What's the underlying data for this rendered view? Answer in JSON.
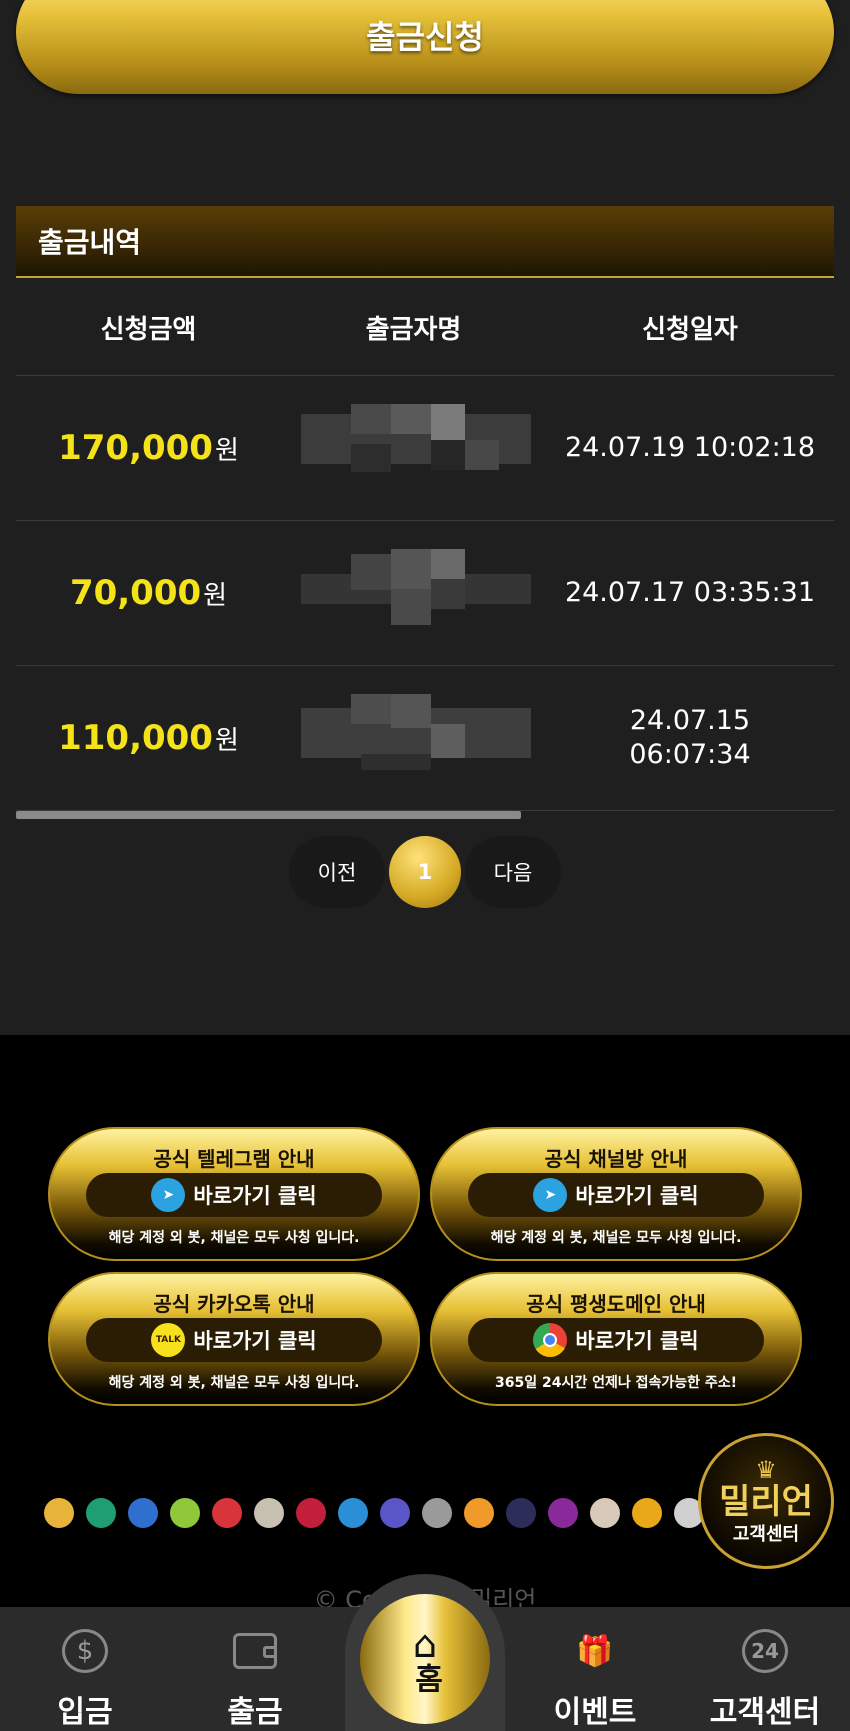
{
  "header": {
    "withdraw_request_label": "출금신청"
  },
  "history": {
    "title": "출금내역",
    "columns": [
      "신청금액",
      "출금자명",
      "신청일자"
    ],
    "currency_suffix": "원",
    "rows": [
      {
        "amount": "170,000",
        "date": "24.07.19 10:02:18",
        "date_line2": ""
      },
      {
        "amount": "70,000",
        "date": "24.07.17 03:35:31",
        "date_line2": ""
      },
      {
        "amount": "110,000",
        "date": "24.07.15",
        "date_line2": "06:07:34"
      }
    ]
  },
  "pagination": {
    "prev": "이전",
    "current": "1",
    "next": "다음"
  },
  "banners": [
    {
      "title": "공식 텔레그램 안내",
      "cta": "바로가기 클릭",
      "note": "해당 계정 외 봇, 채널은 모두 사칭 입니다.",
      "icon": "telegram-icon",
      "color": "#2aa3e0"
    },
    {
      "title": "공식 채널방 안내",
      "cta": "바로가기 클릭",
      "note": "해당 계정 외 봇, 채널은 모두 사칭 입니다.",
      "icon": "telegram-icon",
      "color": "#2aa3e0"
    },
    {
      "title": "공식 카카오톡 안내",
      "cta": "바로가기 클릭",
      "note": "해당 계정 외 봇, 채널은 모두 사칭 입니다.",
      "icon": "kakaotalk-icon",
      "color": "#f7e11c"
    },
    {
      "title": "공식 평생도메인 안내",
      "cta": "바로가기 클릭",
      "note": "365일 24시간 언제나 접속가능한 주소!",
      "icon": "chrome-icon",
      "color": "#4285f4"
    }
  ],
  "support_badge": {
    "brand": "밀리언",
    "label": "고객센터"
  },
  "copyright": "© Copyright 밀리언",
  "tabbar": {
    "deposit": "입금",
    "withdraw": "출금",
    "home": "홈",
    "event": "이벤트",
    "support": "고객센터"
  },
  "colors": {
    "gold": "#e7c23a",
    "amount_yellow": "#f5e31a",
    "background": "#1f1f1f"
  }
}
